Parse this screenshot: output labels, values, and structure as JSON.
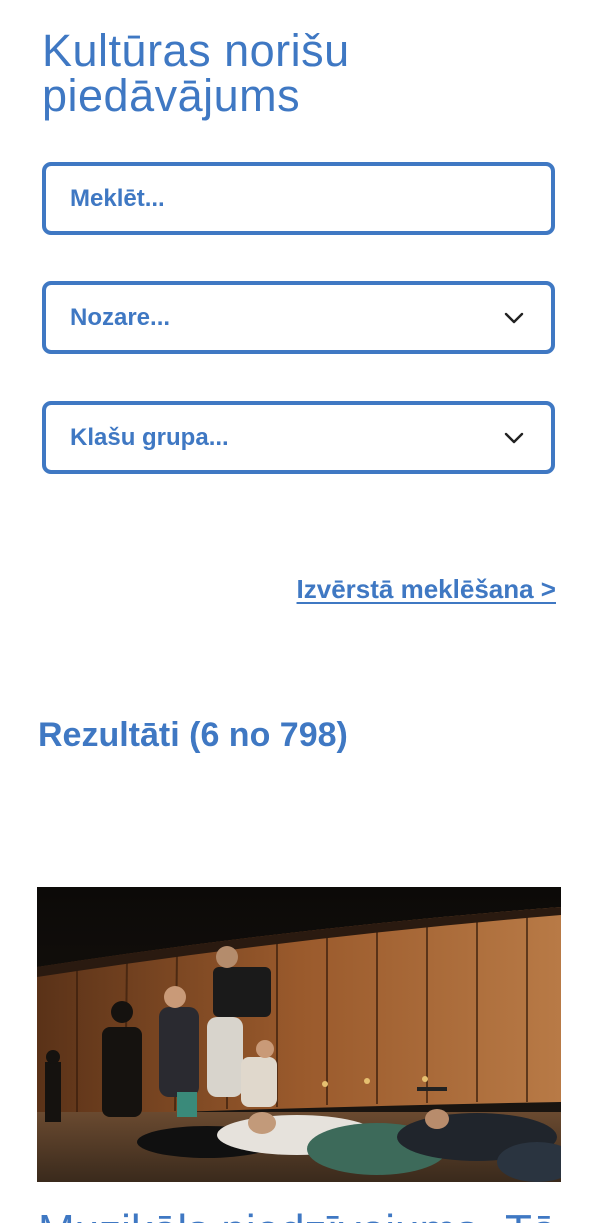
{
  "page": {
    "title": "Kultūras norišu piedāvājums"
  },
  "filters": {
    "search": {
      "placeholder": "Meklēt..."
    },
    "sector": {
      "selected": "Nozare...",
      "icon": "chevron-down-icon"
    },
    "class_group": {
      "selected": "Klašu grupa...",
      "icon": "chevron-down-icon"
    },
    "advanced_link": "Izvērstā meklēšana >"
  },
  "results": {
    "heading": "Rezultāti (6 no 798)"
  },
  "cards": [
    {
      "image": "performance-photo",
      "title": "Muzikāls piedzīvojums „Tā"
    }
  ],
  "colors": {
    "accent": "#3f78c3",
    "background": "#ffffff"
  }
}
